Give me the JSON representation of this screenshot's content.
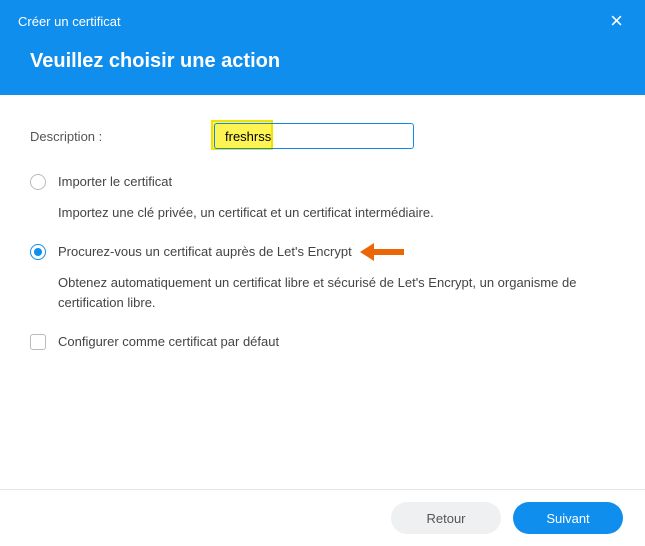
{
  "header": {
    "title": "Créer un certificat",
    "subtitle": "Veuillez choisir une action"
  },
  "form": {
    "descriptionLabel": "Description :",
    "descriptionValue": "freshrss"
  },
  "options": {
    "import": {
      "label": "Importer le certificat",
      "desc": "Importez une clé privée, un certificat et un certificat intermédiaire."
    },
    "letsencrypt": {
      "label": "Procurez-vous un certificat auprès de Let's Encrypt",
      "desc": "Obtenez automatiquement un certificat libre et sécurisé de Let's Encrypt, un organisme de certification libre."
    },
    "default": {
      "label": "Configurer comme certificat par défaut"
    }
  },
  "footer": {
    "back": "Retour",
    "next": "Suivant"
  },
  "colors": {
    "accent": "#0f8eee",
    "arrow": "#ec6608"
  }
}
